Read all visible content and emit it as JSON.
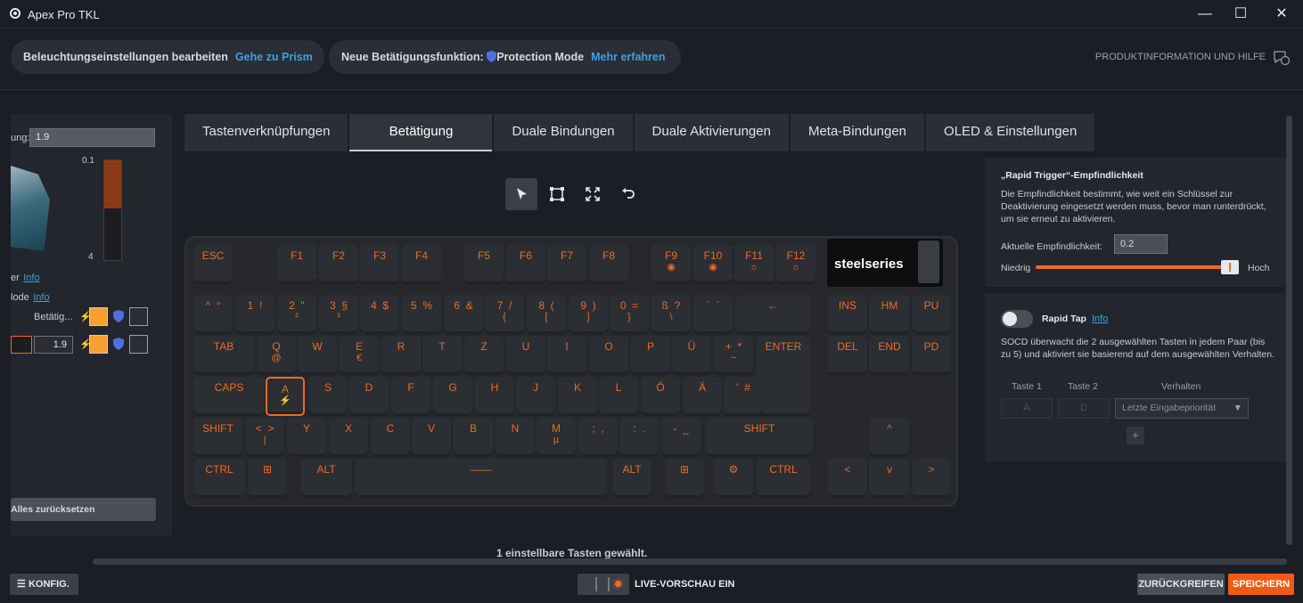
{
  "window": {
    "title": "Apex Pro TKL",
    "minimize": "—",
    "maximize": "☐",
    "close": "✕"
  },
  "banners": {
    "lighting": {
      "text": "Beleuchtungseinstellungen bearbeiten",
      "link": "Gehe zu Prism"
    },
    "actuation": {
      "text": "Neue Betätigungsfunktion:",
      "mode": "Protection Mode",
      "link": "Mehr erfahren"
    }
  },
  "help": {
    "label": "PRODUKTINFORMATION UND HILFE"
  },
  "left_panel": {
    "label_partial": "ung:",
    "input_value": "1.9",
    "scale_top": "0.1",
    "scale_bottom": "4",
    "info1_prefix": "er",
    "info1": "Info",
    "info2_prefix": "lode",
    "info2": "Info",
    "row1_label": "Betätig...",
    "row2_value": "1.9",
    "reset": "Alles zurücksetzen"
  },
  "tabs": [
    "Tastenverknüpfungen",
    "Betätigung",
    "Duale Bindungen",
    "Duale Aktivierungen",
    "Meta-Bindungen",
    "OLED & Einstellungen"
  ],
  "active_tab": "Betätigung",
  "tools": [
    "select-icon",
    "marquee-icon",
    "expand-icon",
    "undo-icon"
  ],
  "keyboard": {
    "oled_logo": "steelseries",
    "rows": [
      [
        {
          "t": "ESC"
        },
        {
          "t": "F1"
        },
        {
          "t": "F2"
        },
        {
          "t": "F3"
        },
        {
          "t": "F4"
        },
        {
          "t": "F5"
        },
        {
          "t": "F6"
        },
        {
          "t": "F7"
        },
        {
          "t": "F8"
        },
        {
          "t": "F9",
          "b": "◉"
        },
        {
          "t": "F10",
          "b": "◉"
        },
        {
          "t": "F11",
          "b": "☼"
        },
        {
          "t": "F12",
          "b": "☼"
        }
      ],
      [
        {
          "t": "^  °"
        },
        {
          "t": "1  !"
        },
        {
          "t": "2  \"",
          "b": "²"
        },
        {
          "t": "3  §",
          "b": "³"
        },
        {
          "t": "4  $"
        },
        {
          "t": "5  %"
        },
        {
          "t": "6  &"
        },
        {
          "t": "7  /",
          "b": "{"
        },
        {
          "t": "8  (",
          "b": "["
        },
        {
          "t": "9  )",
          "b": "]"
        },
        {
          "t": "0  =",
          "b": "}"
        },
        {
          "t": "ß  ?",
          "b": "\\"
        },
        {
          "t": "´  `"
        },
        {
          "t": "←"
        },
        {
          "t": "INS"
        },
        {
          "t": "HM"
        },
        {
          "t": "PU"
        }
      ],
      [
        {
          "t": "TAB"
        },
        {
          "t": "Q",
          "b": "@"
        },
        {
          "t": "W"
        },
        {
          "t": "E",
          "b": "€"
        },
        {
          "t": "R"
        },
        {
          "t": "T"
        },
        {
          "t": "Z"
        },
        {
          "t": "U"
        },
        {
          "t": "I"
        },
        {
          "t": "O"
        },
        {
          "t": "P"
        },
        {
          "t": "Ü"
        },
        {
          "t": "+  *",
          "b": "~"
        },
        {
          "t": "ENTER"
        },
        {
          "t": "DEL"
        },
        {
          "t": "END"
        },
        {
          "t": "PD"
        }
      ],
      [
        {
          "t": "CAPS"
        },
        {
          "t": "A",
          "b": "⚡"
        },
        {
          "t": "S"
        },
        {
          "t": "D"
        },
        {
          "t": "F"
        },
        {
          "t": "G"
        },
        {
          "t": "H"
        },
        {
          "t": "J"
        },
        {
          "t": "K"
        },
        {
          "t": "L"
        },
        {
          "t": "Ö"
        },
        {
          "t": "Ä"
        },
        {
          "t": "'  #"
        }
      ],
      [
        {
          "t": "SHIFT"
        },
        {
          "t": "<  >",
          "b": "|"
        },
        {
          "t": "Y"
        },
        {
          "t": "X"
        },
        {
          "t": "C"
        },
        {
          "t": "V"
        },
        {
          "t": "B"
        },
        {
          "t": "N"
        },
        {
          "t": "M",
          "b": "µ"
        },
        {
          "t": ";  ,"
        },
        {
          "t": ":  ."
        },
        {
          "t": "-  _"
        },
        {
          "t": "SHIFT"
        },
        {
          "t": "^"
        }
      ],
      [
        {
          "t": "CTRL"
        },
        {
          "t": "⊞"
        },
        {
          "t": "ALT"
        },
        {
          "t": "——"
        },
        {
          "t": "ALT"
        },
        {
          "t": "⊞"
        },
        {
          "t": "⚙"
        },
        {
          "t": "CTRL"
        },
        {
          "t": "<"
        },
        {
          "t": "v"
        },
        {
          "t": ">"
        }
      ]
    ]
  },
  "rapid_trigger": {
    "title": "„Rapid Trigger“-Empfindlichkeit",
    "desc": "Die Empfindlichkeit bestimmt, wie weit ein Schlüssel zur Deaktivierung eingesetzt werden muss, bevor man runterdrückt, um sie erneut zu aktivieren.",
    "current_label": "Aktuelle Empfindlichkeit:",
    "current_value": "0.2",
    "low": "Niedrig",
    "high": "Hoch",
    "slider_level": 0.98
  },
  "rapid_tap": {
    "label": "Rapid Tap",
    "info": "Info",
    "enabled": false,
    "desc": "SOCD überwacht die 2 ausgewählten Tasten in jedem Paar (bis zu 5) und aktiviert sie basierend auf dem ausgewählten Verhalten.",
    "col1": "Taste 1",
    "col2": "Taste 2",
    "col3": "Verhalten",
    "key1": "A",
    "key2": "D",
    "behavior": "Letzte Eingabepriorität",
    "add": "+"
  },
  "status": "1 einstellbare Tasten gewählt.",
  "bottom": {
    "config": "KONFIG.",
    "live": "LIVE-VORSCHAU EIN",
    "revert": "ZURÜCKGREIFEN",
    "save": "SPEICHERN"
  },
  "colors": {
    "accent": "#f06a22",
    "link": "#3d9fe0",
    "shield": "#4f6fe0"
  }
}
